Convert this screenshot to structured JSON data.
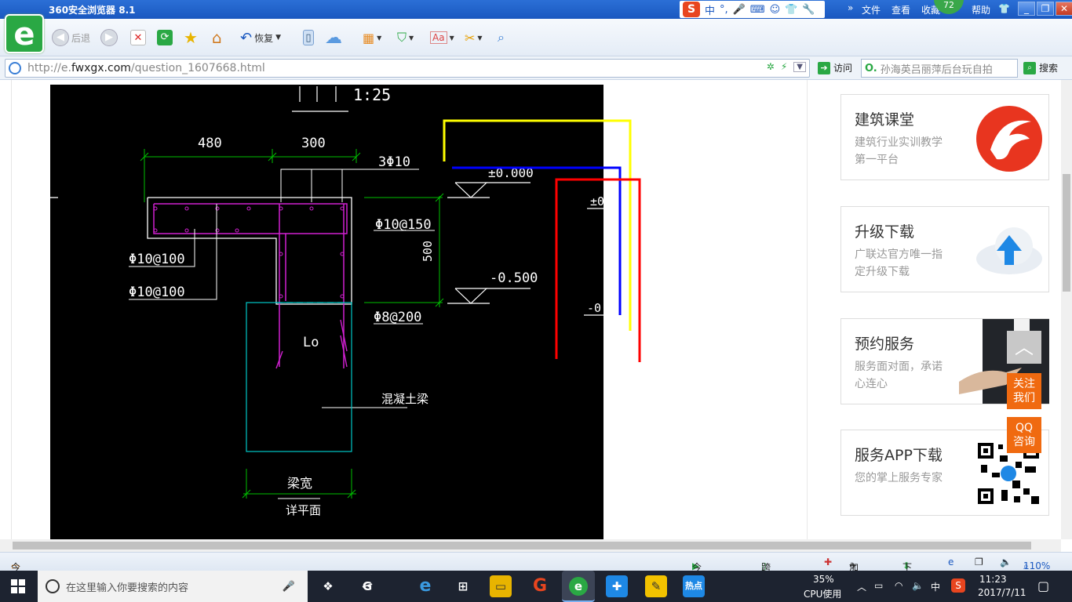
{
  "window": {
    "title": "360安全浏览器 8.1",
    "ime_label": "中",
    "ime_punct": "°,",
    "menus": [
      "文件",
      "查看",
      "收藏"
    ],
    "score_badge": "72",
    "help": "帮助",
    "buttons": {
      "minimize": "_",
      "maximize": "❐",
      "close": "✕"
    }
  },
  "toolbar": {
    "back_label": "后退",
    "restore_label": "恢复"
  },
  "address": {
    "url_prefix": "http://e.",
    "url_domain": "fwxgx.com",
    "url_path": "/question_1607668.html",
    "visit_label": "访问",
    "search_value": "孙海英吕丽萍后台玩自拍",
    "search_button": "搜索"
  },
  "drawing": {
    "title_partial": "1:25",
    "dim_480": "480",
    "dim_300": "300",
    "rebar_top": "3Φ10",
    "elev_zero": "±0.000",
    "elev_zero_partial": "±0",
    "rebar_150": "Φ10@150",
    "dim_500": "500",
    "rebar_100a": "Φ10@100",
    "rebar_100b": "Φ10@100",
    "elev_neg": "-0.500",
    "elev_neg_partial": "-0.",
    "rebar_200": "Φ8@200",
    "lo_label": "Lo",
    "concrete_beam": "混凝土梁",
    "beam_width": "梁宽",
    "detail_plan": "详平面"
  },
  "sidebar": {
    "cards": [
      {
        "title": "建筑课堂",
        "desc": "建筑行业实训教学第一平台"
      },
      {
        "title": "升级下载",
        "desc": "广联达官方唯一指定升级下载"
      },
      {
        "title": "预约服务",
        "desc": "服务面对面，承诺心连心"
      },
      {
        "title": "服务APP下载",
        "desc": "您的掌上服务专家"
      }
    ],
    "float_top": "︿",
    "follow_us": "关注我们",
    "qq_consult": "QQ咨询"
  },
  "statusbar": {
    "today_pick": "今日优选",
    "today_live": "今日直播",
    "cross_screen": "跨屏浏览",
    "accelerator": "加速器",
    "download": "下载",
    "zoom": "110%"
  },
  "taskbar": {
    "search_placeholder": "在这里输入你要搜索的内容",
    "cpu_percent": "35%",
    "cpu_label": "CPU使用",
    "ime": "中",
    "time": "11:23",
    "date": "2017/7/11"
  },
  "colors": {
    "browser_green": "#2aa844",
    "title_blue": "#1a58c0",
    "cad_green": "#00c000",
    "cad_magenta": "#d020d0",
    "cad_cyan": "#00c8c8",
    "annot_yellow": "#ffff00",
    "annot_blue": "#0000ff",
    "annot_red": "#ff0000",
    "float_orange": "#f06a10"
  }
}
